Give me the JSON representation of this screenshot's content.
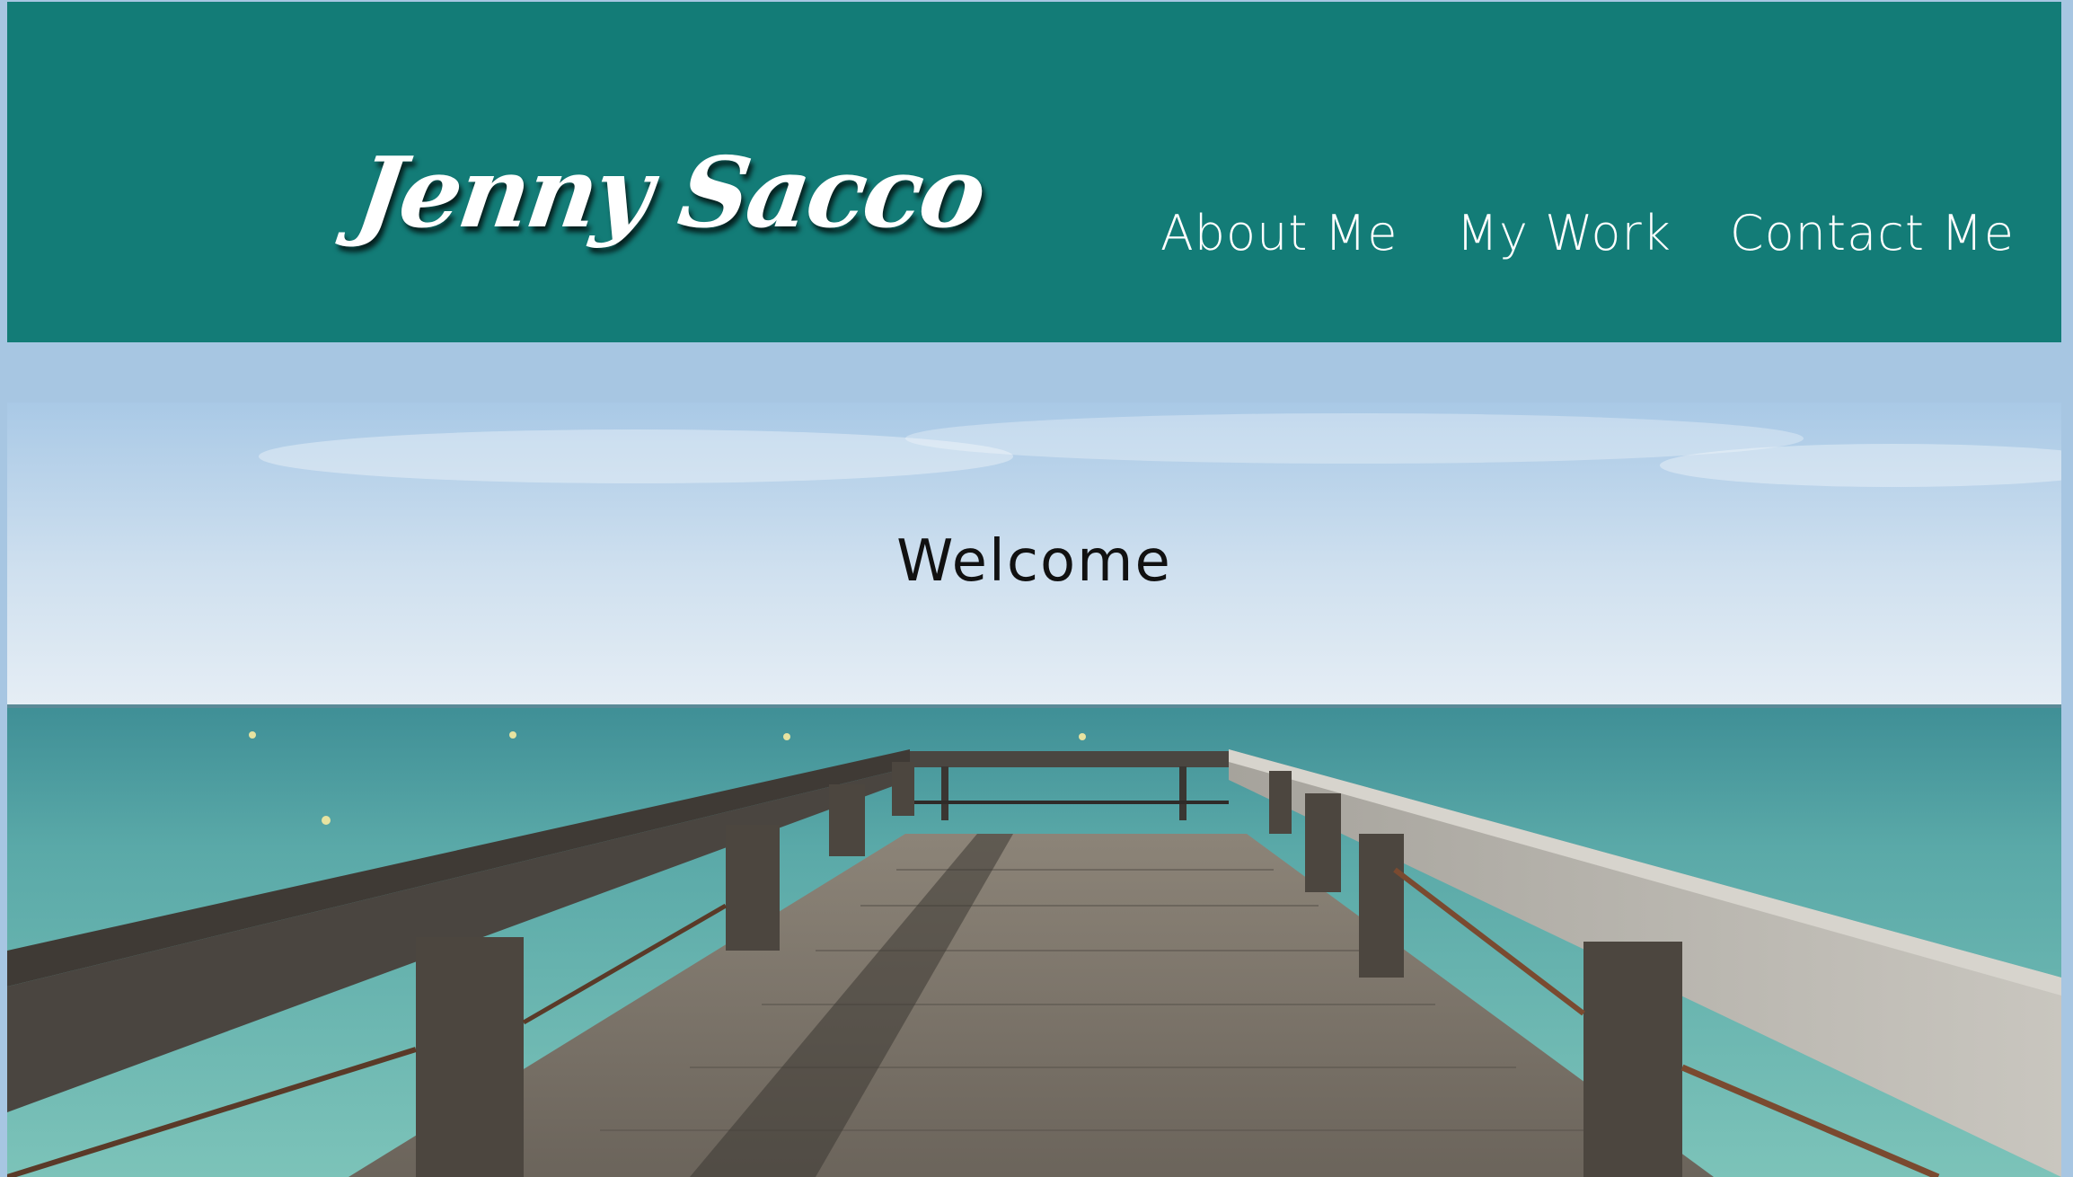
{
  "header": {
    "logo_text": "Jenny Sacco",
    "bg_color": "#137c77"
  },
  "nav": {
    "items": [
      {
        "label": "About Me"
      },
      {
        "label": "My Work"
      },
      {
        "label": "Contact Me"
      }
    ]
  },
  "hero": {
    "heading": "Welcome",
    "image": "pier-over-ocean-photo"
  },
  "colors": {
    "page_bg": "#a7c6e2",
    "nav_text": "#ffffff",
    "heading_text": "#111111"
  }
}
